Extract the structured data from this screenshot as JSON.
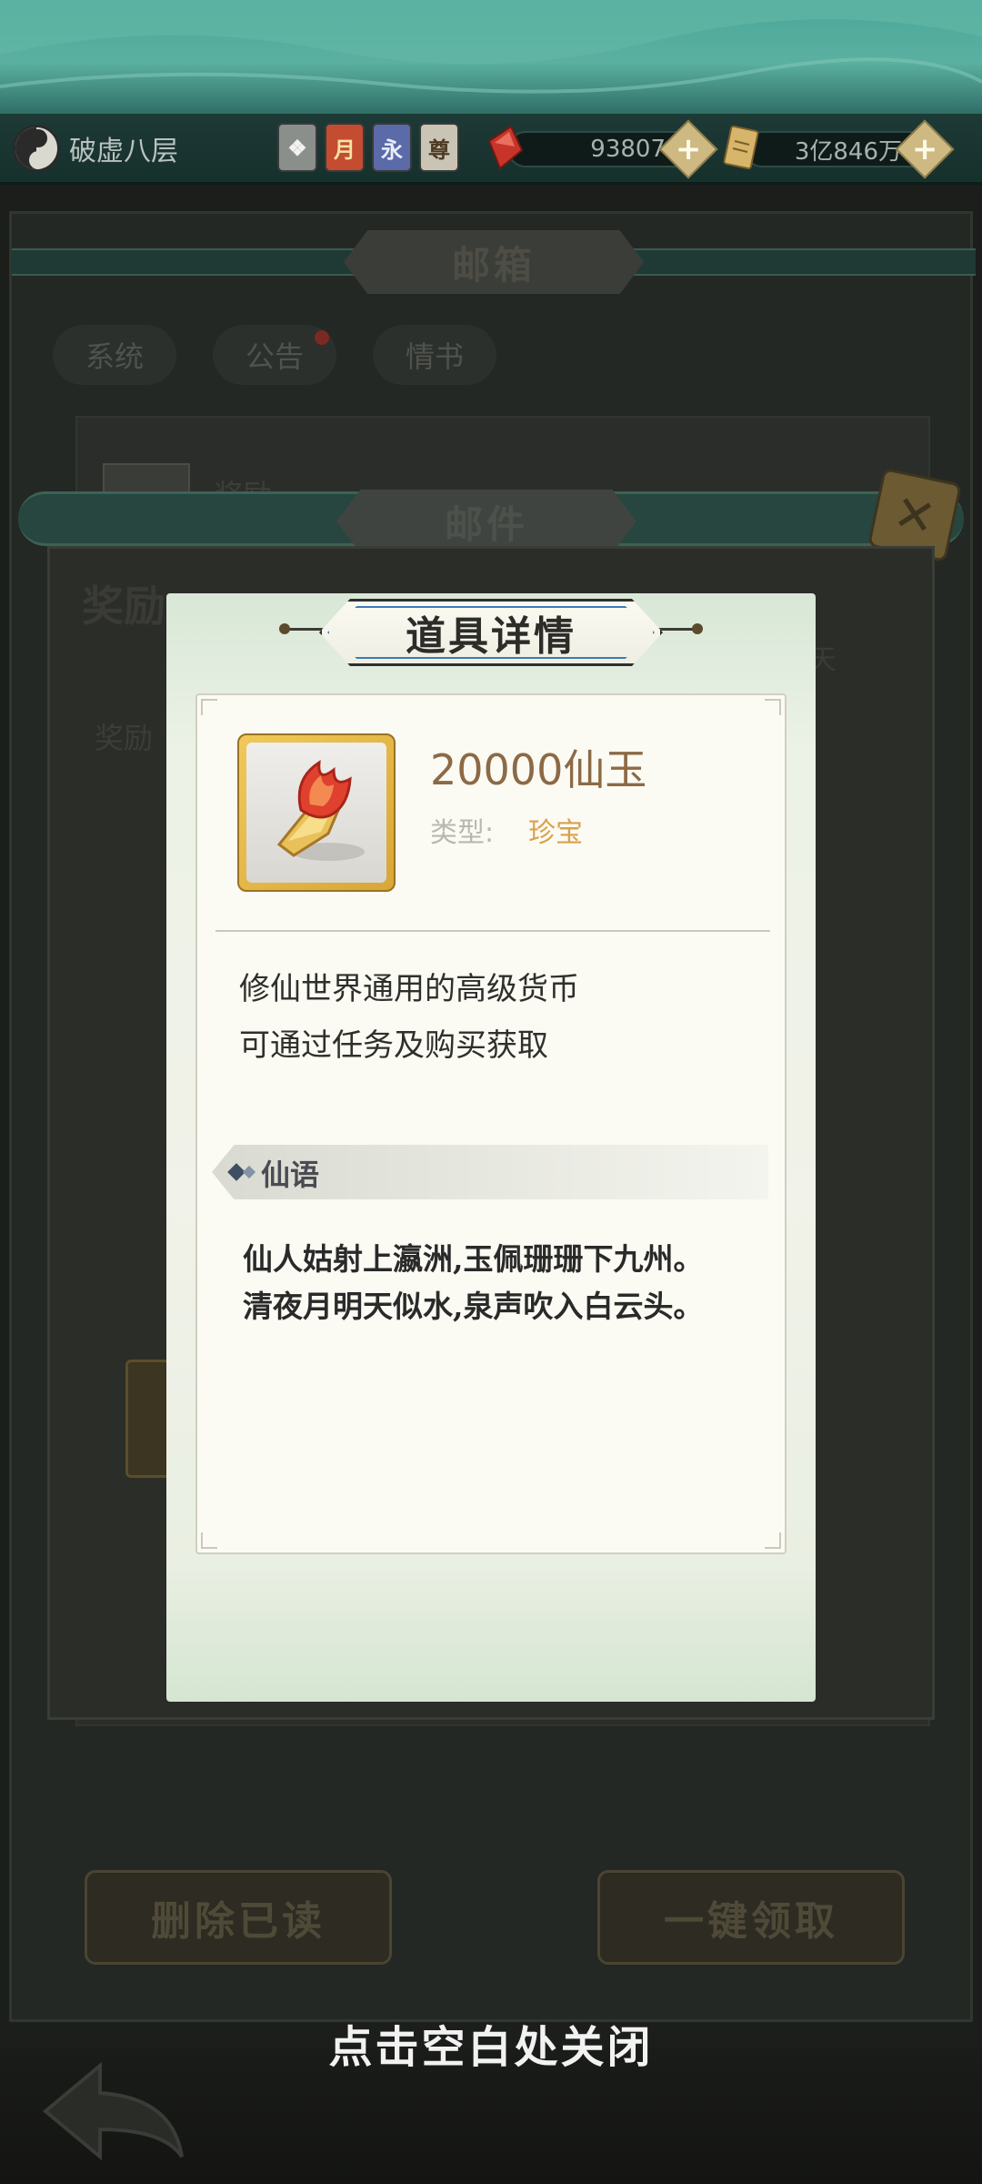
{
  "topbar": {
    "realm": "破虚八层",
    "badges": [
      "月",
      "永",
      "尊"
    ],
    "currency1": "93807",
    "currency2": "3亿846万"
  },
  "mailbox": {
    "title": "邮箱",
    "tabs": [
      "系统",
      "公告",
      "情书"
    ],
    "mail_preview": "奖励",
    "delete_read": "删除已读",
    "claim_all": "一键领取"
  },
  "mail": {
    "title": "邮件",
    "panel_title": "奖励",
    "reward_label": "奖励",
    "days": "天"
  },
  "item_detail": {
    "title": "道具详情",
    "name": "20000仙玉",
    "type_label": "类型:",
    "type_value": "珍宝",
    "description": [
      "修仙世界通用的高级货币",
      "可通过任务及购买获取"
    ],
    "section_title": "仙语",
    "poem": [
      "仙人姑射上瀛洲,玉佩珊珊下九州。",
      "清夜月明天似水,泉声吹入白云头。"
    ]
  },
  "close_hint": "点击空白处关闭",
  "colors": {
    "accent_gold": "#d9a24b",
    "item_name": "#8c6a45",
    "popup_bg": "#f1f2e9"
  }
}
